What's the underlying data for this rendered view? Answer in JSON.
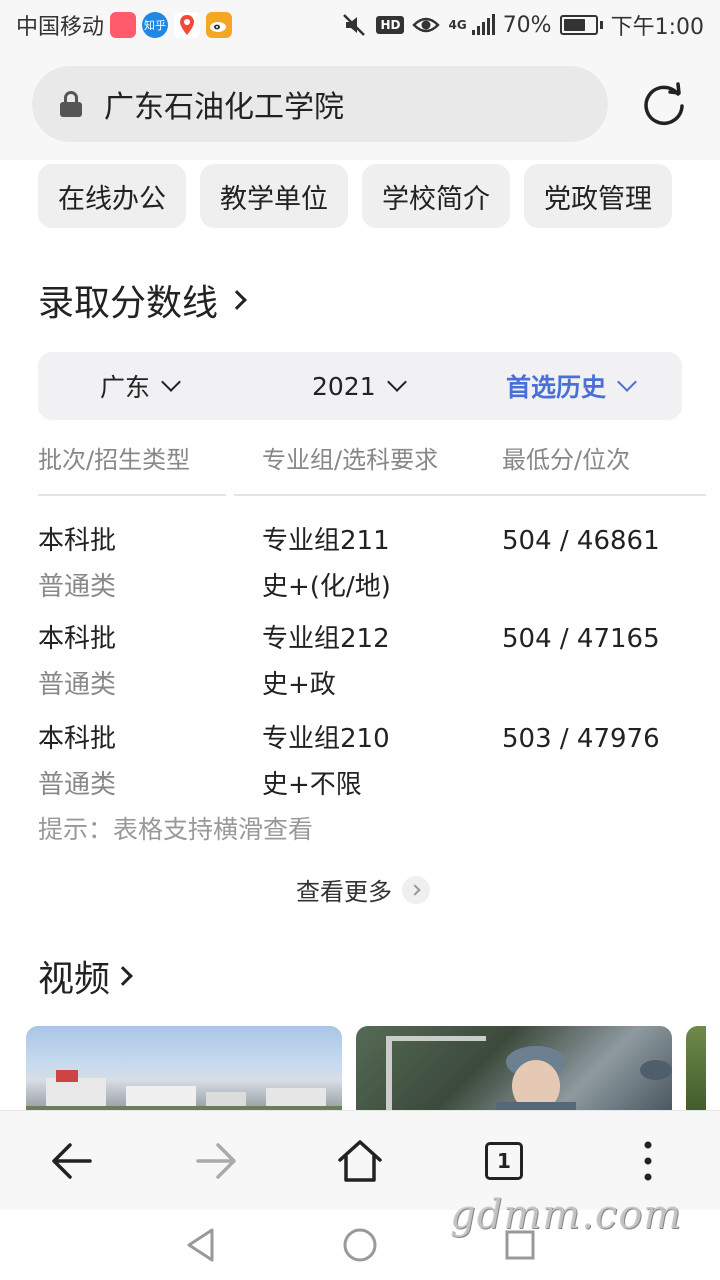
{
  "status_bar": {
    "carrier": "中国移动",
    "app_icons": [
      {
        "name": "taobao-icon",
        "color": "#ff5b6b",
        "text": ""
      },
      {
        "name": "zhihu-icon",
        "color": "#1e88e5",
        "text": "知乎"
      },
      {
        "name": "map-pin-icon",
        "color": "#f04b3a",
        "text": ""
      },
      {
        "name": "weibo-icon",
        "color": "#f5a623",
        "text": ""
      }
    ],
    "hd": "HD",
    "network": "4G",
    "battery_percent": "70%",
    "battery_level": 0.7,
    "time": "下午1:00"
  },
  "address_bar": {
    "title": "广东石油化工学院"
  },
  "quick_links": [
    "在线办公",
    "教学单位",
    "学校简介",
    "党政管理"
  ],
  "score_section": {
    "title": "录取分数线",
    "filters": {
      "province": "广东",
      "year": "2021",
      "subject": "首选历史"
    },
    "accent_color": "#4a6fd6",
    "headers": [
      "批次/招生类型",
      "专业组/选科要求",
      "最低分/位次"
    ],
    "rows": [
      {
        "batch": "本科批",
        "type": "普通类",
        "group": "专业组211",
        "requirement": "史+(化/地)",
        "score": "504 / 46861"
      },
      {
        "batch": "本科批",
        "type": "普通类",
        "group": "专业组212",
        "requirement": "史+政",
        "score": "504 / 47165"
      },
      {
        "batch": "本科批",
        "type": "普通类",
        "group": "专业组210",
        "requirement": "史+不限",
        "score": "503 / 47976"
      }
    ],
    "hint": "提示：表格支持横滑查看",
    "more": "查看更多"
  },
  "video_section": {
    "title": "视频"
  },
  "toolbar": {
    "tab_count": "1"
  },
  "watermark": "gdmm.com"
}
